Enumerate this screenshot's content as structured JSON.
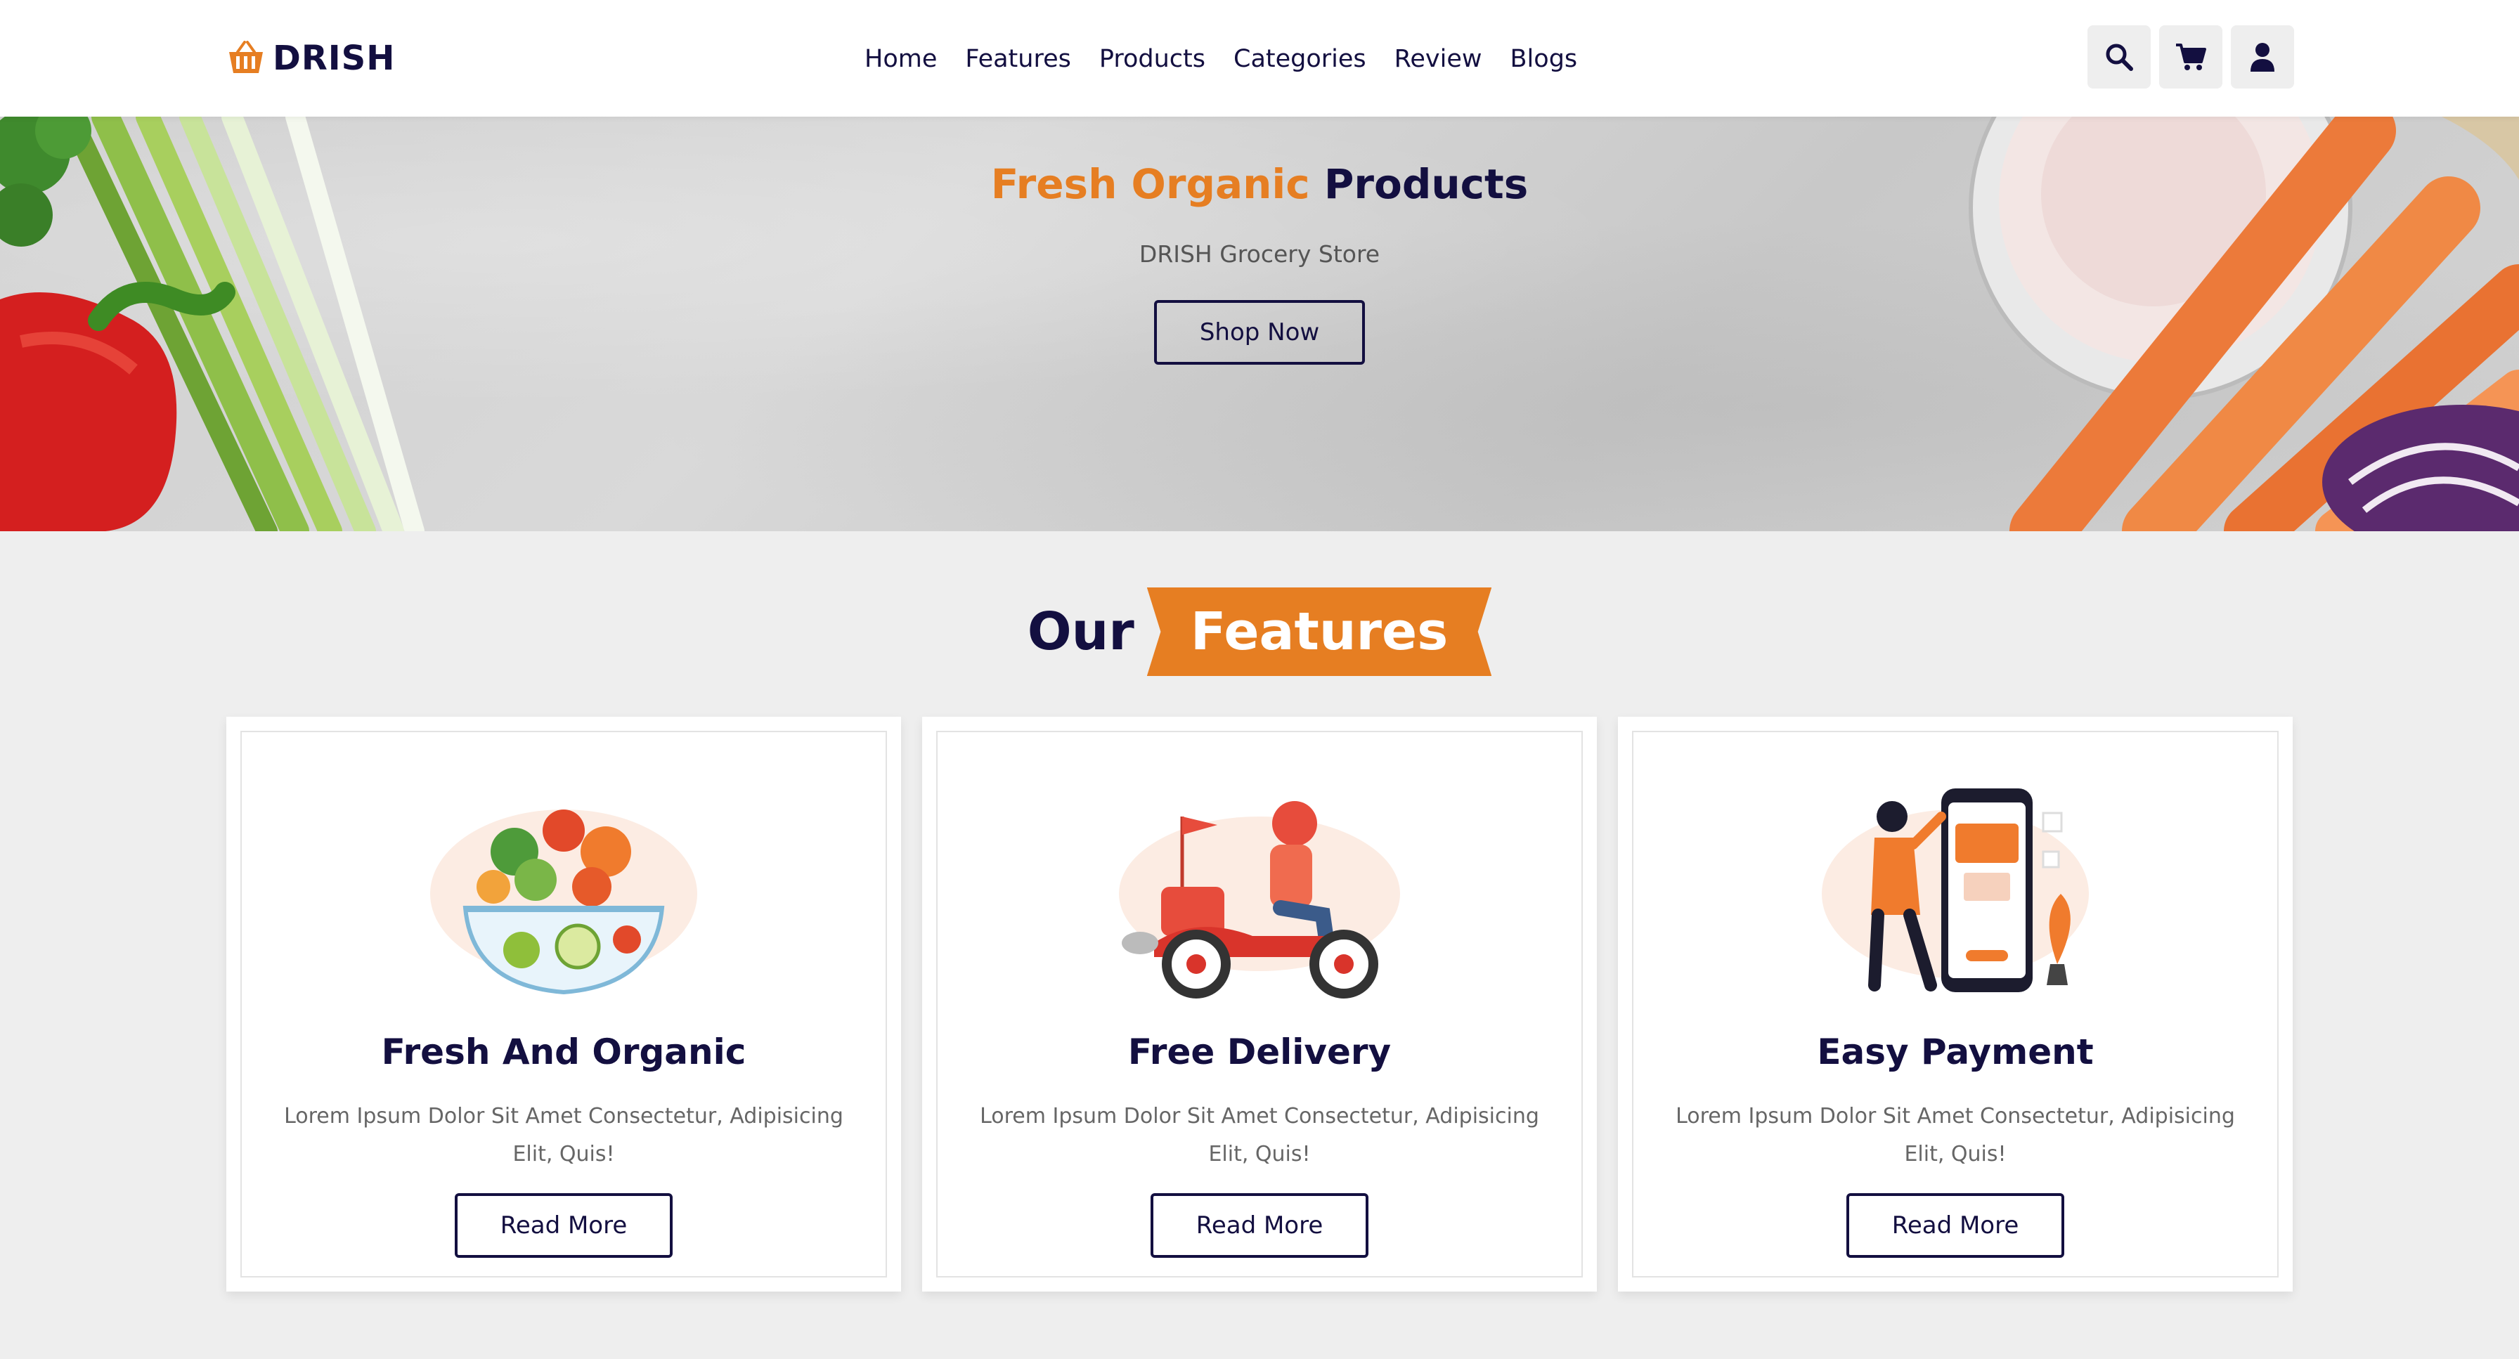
{
  "header": {
    "logo_text": "DRISH",
    "nav": [
      "Home",
      "Features",
      "Products",
      "Categories",
      "Review",
      "Blogs"
    ],
    "icons": [
      "search-icon",
      "cart-icon",
      "user-icon"
    ]
  },
  "hero": {
    "title_accent": "Fresh Organic",
    "title_rest": "Products",
    "subtitle": "DRISH Grocery Store",
    "button": "Shop Now"
  },
  "features": {
    "heading_plain": "Our",
    "heading_accent": "Features",
    "cards": [
      {
        "title": "Fresh And Organic",
        "text": "Lorem Ipsum Dolor Sit Amet Consectetur, Adipisicing Elit, Quis!",
        "button": "Read More",
        "image": "salad-bowl-illustration"
      },
      {
        "title": "Free Delivery",
        "text": "Lorem Ipsum Dolor Sit Amet Consectetur, Adipisicing Elit, Quis!",
        "button": "Read More",
        "image": "delivery-scooter-illustration"
      },
      {
        "title": "Easy Payment",
        "text": "Lorem Ipsum Dolor Sit Amet Consectetur, Adipisicing Elit, Quis!",
        "button": "Read More",
        "image": "mobile-payment-illustration"
      }
    ]
  },
  "colors": {
    "accent": "#e67e22",
    "dark": "#130f40",
    "page_bg": "#eeeeee"
  }
}
